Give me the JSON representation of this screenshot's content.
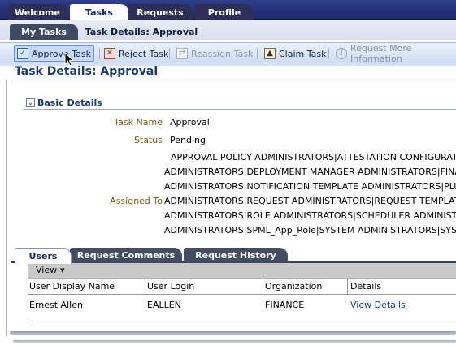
{
  "top_tabs": [
    {
      "label": "Welcome"
    },
    {
      "label": "Tasks"
    },
    {
      "label": "Requests"
    },
    {
      "label": "Profile"
    }
  ],
  "sub_tabs": [
    {
      "label": "My Tasks"
    },
    {
      "label": "Task Details: Approval"
    }
  ],
  "toolbar": {
    "approve_label": "Approve Task",
    "reject_label": "Reject Task",
    "reassign_label": "Reassign Task",
    "claim_label": "Claim Task",
    "request_info_label": "Request More Information"
  },
  "page_title": "Task Details: Approval",
  "basic_details": {
    "heading": "Basic Details",
    "task_name_label": "Task Name",
    "task_name": "Approval",
    "status_label": "Status",
    "status": "Pending",
    "assigned_to_label": "Assigned To",
    "assigned_to_lines": [
      "APPROVAL POLICY ADMINISTRATORS|ATTESTATION CONFIGURATION",
      "ADMINISTRATORS|DEPLOYMENT MANAGER ADMINISTRATORS|FINANCE",
      "ADMINISTRATORS|NOTIFICATION TEMPLATE ADMINISTRATORS|PLUGIN",
      "ADMINISTRATORS|REQUEST ADMINISTRATORS|REQUEST TEMPLATE",
      "ADMINISTRATORS|ROLE ADMINISTRATORS|SCHEDULER ADMINISTRATORS",
      "ADMINISTRATORS|SPML_App_Role|SYSTEM ADMINISTRATORS|SYSTEM"
    ]
  },
  "bottom_tabs": [
    {
      "label": "Users"
    },
    {
      "label": "Request Comments"
    },
    {
      "label": "Request History"
    }
  ],
  "view_menu": {
    "label": "View"
  },
  "users_table": {
    "columns": [
      "User Display Name",
      "User Login",
      "Organization",
      "Details"
    ],
    "rows": [
      {
        "display_name": "Ernest Allen",
        "login": "EALLEN",
        "organization": "FINANCE",
        "details": "View Details"
      }
    ]
  },
  "colors": {
    "top_bar": "#1d2a6e",
    "toolbar": "#cfdcf3",
    "title": "#1c3b6e",
    "label": "#7a5a12",
    "link": "#0a3a8a"
  }
}
